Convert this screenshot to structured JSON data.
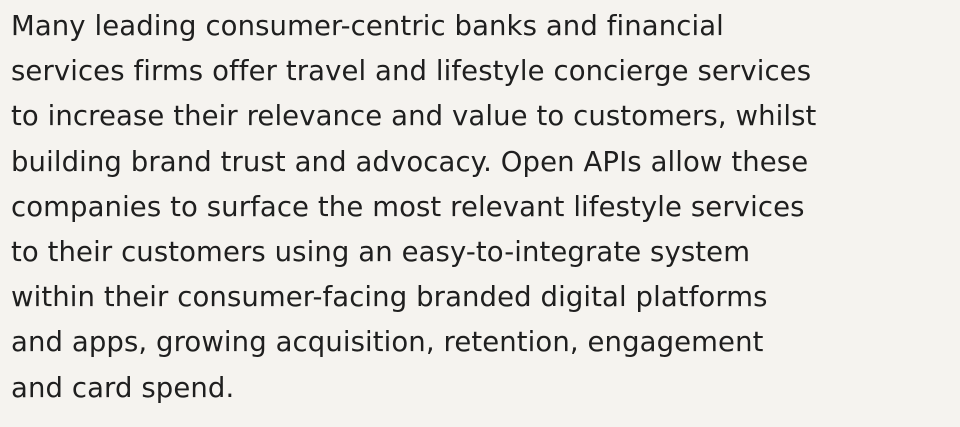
{
  "article": {
    "lines": [
      "Many leading consumer-centric banks and financial",
      "services firms offer travel and lifestyle concierge services",
      "to increase their relevance and value to customers, whilst",
      "building brand trust and advocacy. Open APIs allow these",
      "companies to surface the most relevant lifestyle services",
      "to their customers using an easy-to-integrate system",
      "within their consumer-facing branded digital platforms",
      "and apps, growing acquisition, retention, engagement",
      "and card spend."
    ]
  }
}
